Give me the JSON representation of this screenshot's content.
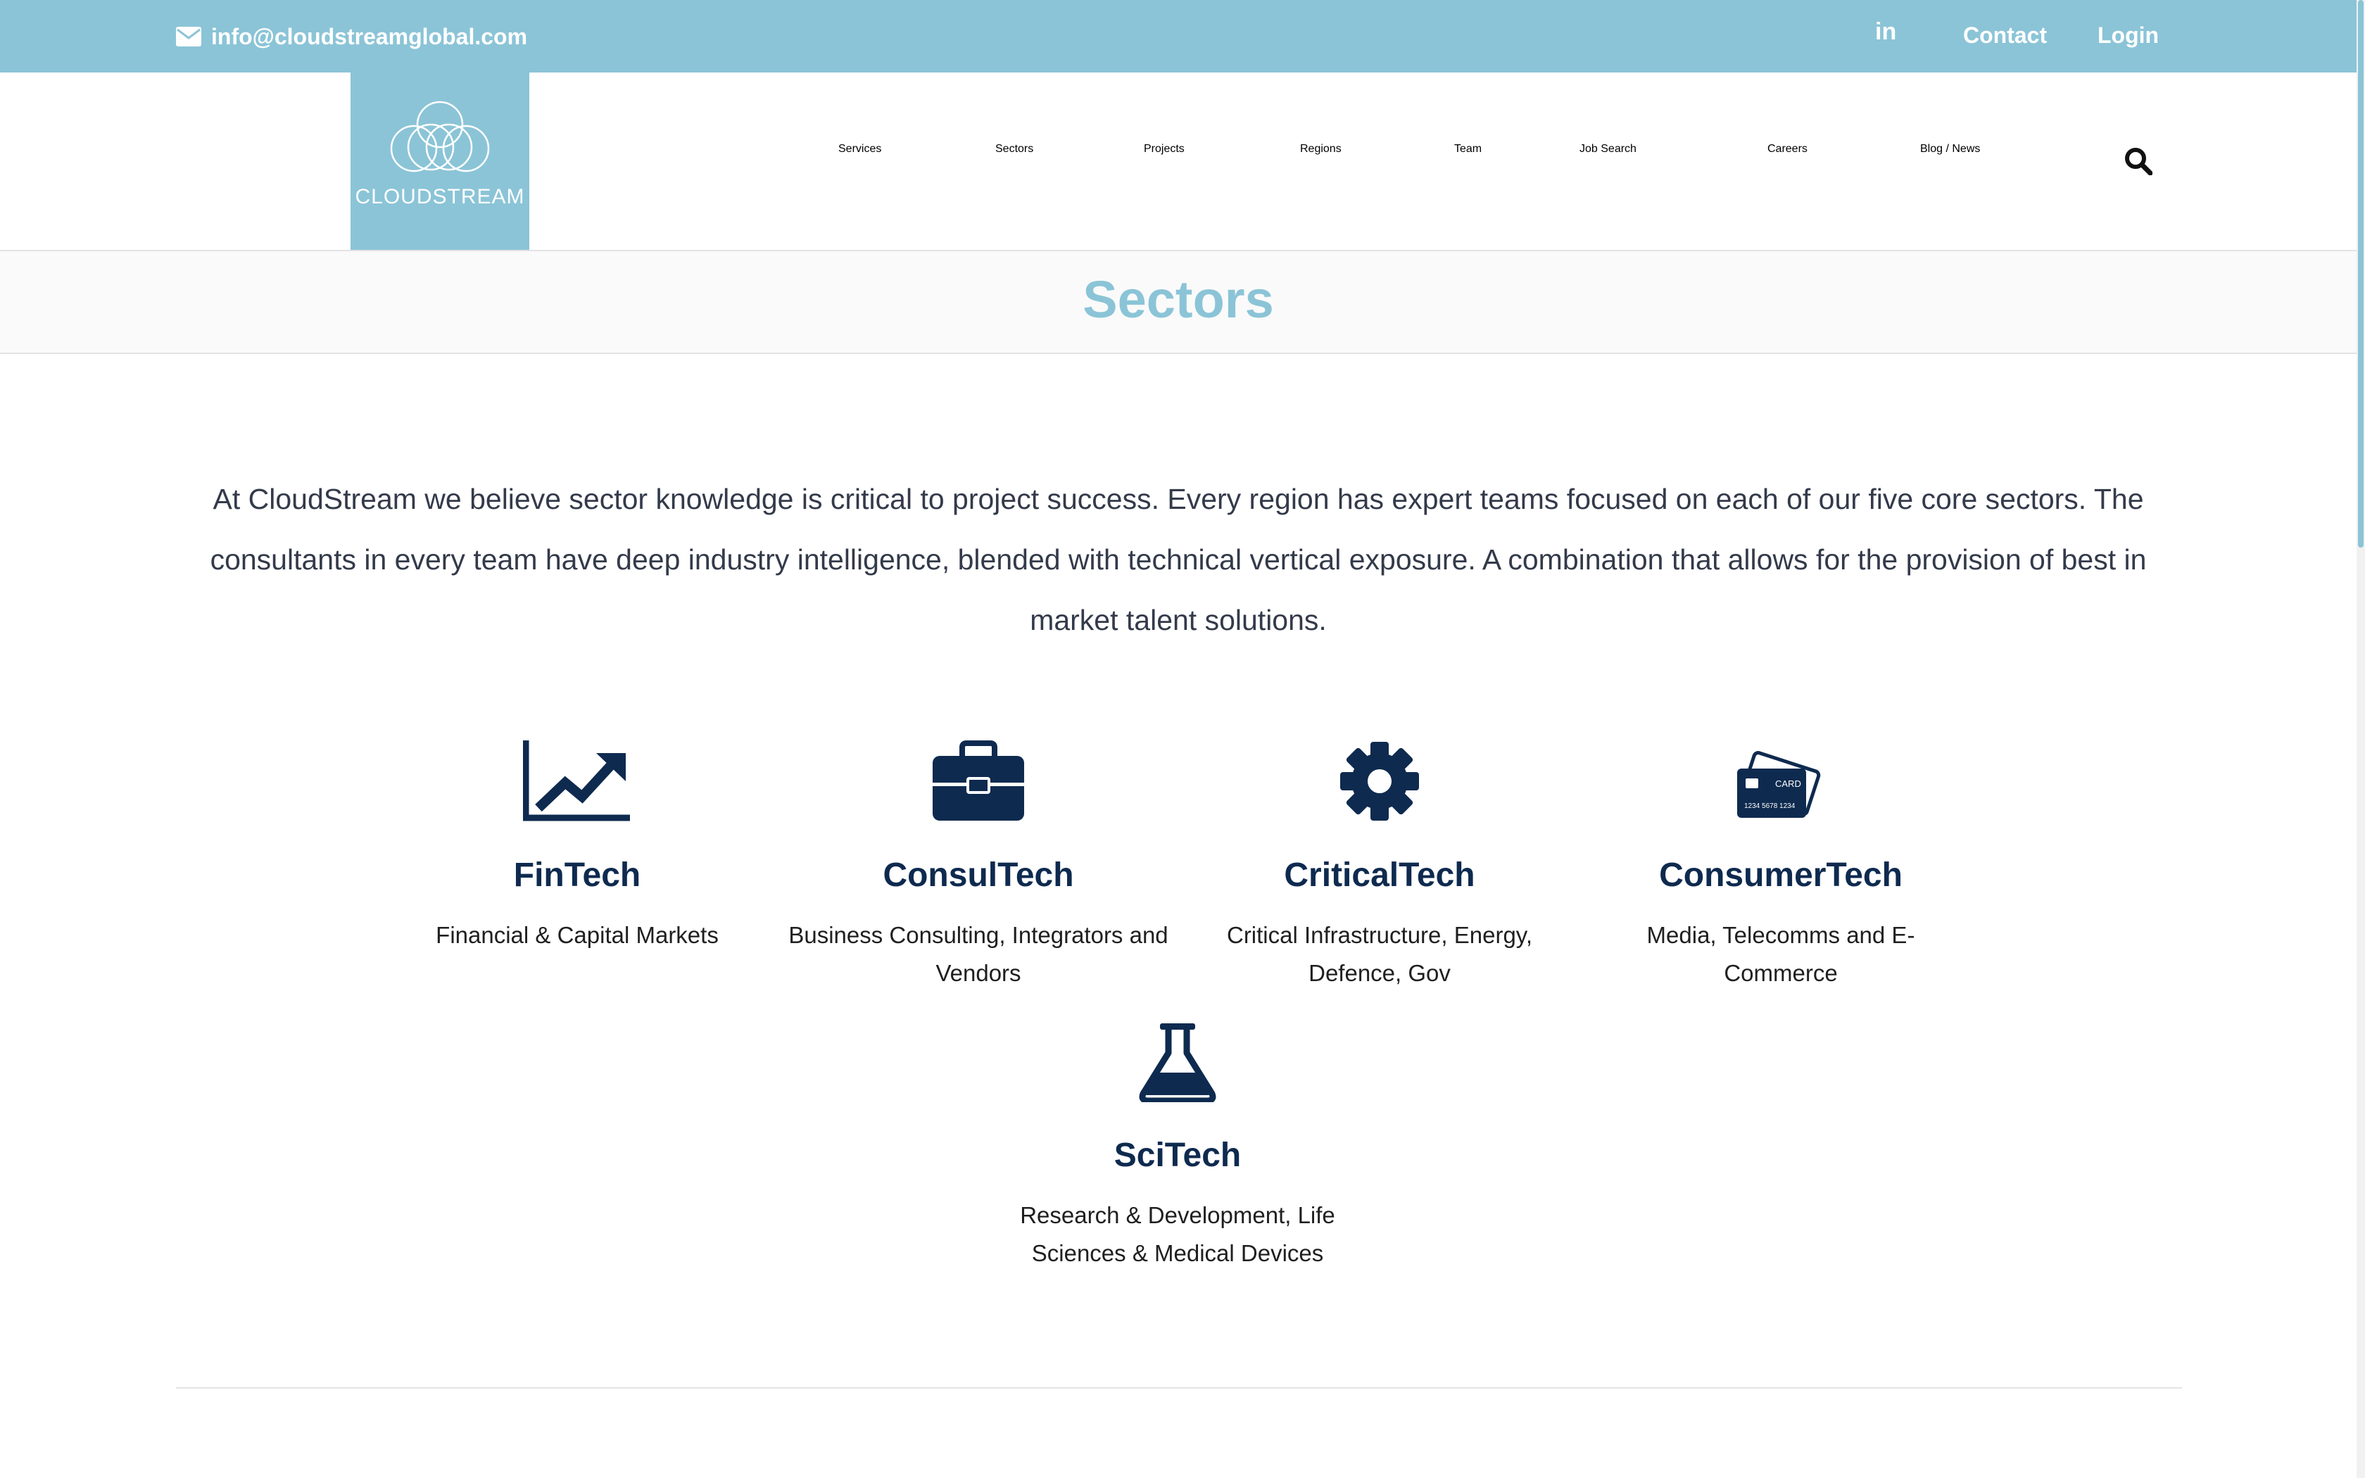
{
  "topbar": {
    "email": "info@cloudstreamglobal.com",
    "linkedin": "in",
    "contact": "Contact",
    "login": "Login"
  },
  "logo": {
    "text": "CLOUDSTREAM"
  },
  "nav": {
    "items": [
      "Services",
      "Sectors",
      "Projects",
      "Regions",
      "Team",
      "Job Search",
      "Careers",
      "Blog / News"
    ]
  },
  "page": {
    "title": "Sectors",
    "intro": "At CloudStream we believe sector knowledge is critical to project success. Every region has expert teams focused on each of our five core sectors. The consultants in every team have deep industry intelligence, blended with technical vertical exposure. A combination that allows for the provision of best in market talent solutions."
  },
  "sectors": [
    {
      "name": "FinTech",
      "desc": "Financial & Capital Markets",
      "icon": "chart-line-icon"
    },
    {
      "name": "ConsulTech",
      "desc": "Business Consulting, Integrators and Vendors",
      "icon": "briefcase-icon"
    },
    {
      "name": "CriticalTech",
      "desc": "Critical Infrastructure, Energy, Defence, Gov",
      "icon": "gear-icon"
    },
    {
      "name": "ConsumerTech",
      "desc": "Media, Telecomms and E-Commerce",
      "icon": "credit-card-icon"
    },
    {
      "name": "SciTech",
      "desc": "Research & Development, Life Sciences & Medical Devices",
      "icon": "flask-icon"
    }
  ],
  "colors": {
    "accent": "#8bc4d7",
    "navy": "#0e2a4f"
  }
}
